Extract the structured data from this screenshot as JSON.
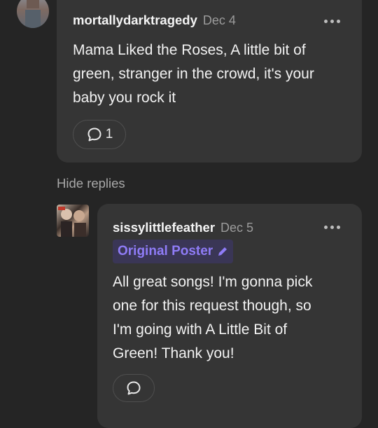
{
  "comment": {
    "username": "mortallydarktragedy",
    "date": "Dec 4",
    "text_lines": [
      "Mama Liked the Roses, A little bit of",
      "green, stranger in the crowd, it's your",
      "baby you rock it"
    ],
    "reply_count": "1"
  },
  "hide_replies_label": "Hide replies",
  "reply": {
    "username": "sissylittlefeather",
    "date": "Dec 5",
    "badge": "Original Poster",
    "text_lines": [
      "All great songs! I'm gonna pick",
      "one for this request though, so",
      "I'm going with A Little Bit of",
      "Green! Thank you!"
    ]
  },
  "colors": {
    "background": "#252525",
    "card": "#353535",
    "op_badge_text": "#8f7cf7",
    "op_badge_bg": "#3a3656"
  },
  "icons": [
    "more-options-icon",
    "speech-bubble-icon",
    "pencil-icon"
  ]
}
